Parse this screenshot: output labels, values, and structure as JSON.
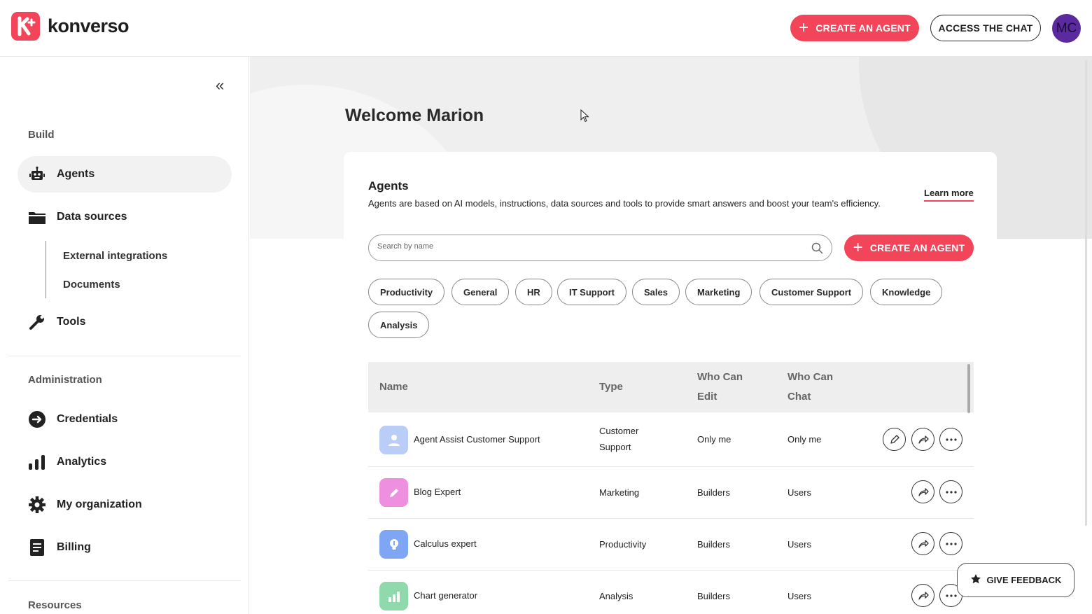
{
  "brand": {
    "name": "konverso",
    "color": "#f2455a"
  },
  "header": {
    "create_agent_label": "CREATE AN AGENT",
    "access_chat_label": "ACCESS THE CHAT",
    "avatar_initials": "MC",
    "avatar_color": "#5b2a9e"
  },
  "sidebar": {
    "collapse_glyph": "«",
    "build_label": "Build",
    "nav_build": [
      {
        "label": "Agents",
        "icon": "robot-icon",
        "active": true
      },
      {
        "label": "Data sources",
        "icon": "folder-icon"
      },
      {
        "label": "Tools",
        "icon": "wrench-icon"
      }
    ],
    "data_sources_sub": [
      "External integrations",
      "Documents"
    ],
    "administration_label": "Administration",
    "nav_admin": [
      {
        "label": "Credentials",
        "icon": "login-arrow-icon"
      },
      {
        "label": "Analytics",
        "icon": "bar-chart-icon"
      },
      {
        "label": "My organization",
        "icon": "gear-icon"
      },
      {
        "label": "Billing",
        "icon": "invoice-icon"
      }
    ],
    "resources_label": "Resources"
  },
  "main": {
    "welcome": "Welcome Marion",
    "agents_title": "Agents",
    "agents_desc": "Agents are based on AI models, instructions, data sources and tools to provide smart answers and boost your team's efficiency.",
    "learn_more": "Learn more",
    "search_placeholder": "Search by name",
    "create_agent_label": "CREATE AN AGENT",
    "categories": [
      "Productivity",
      "General",
      "HR",
      "IT Support",
      "Sales",
      "Marketing",
      "Customer Support",
      "Knowledge",
      "Analysis"
    ],
    "table": {
      "headers": {
        "name": "Name",
        "type": "Type",
        "who_edit": "Who Can Edit",
        "who_chat": "Who Can Chat"
      },
      "rows": [
        {
          "name": "Agent Assist Customer Support",
          "type": "Customer Support",
          "edit": "Only me",
          "chat": "Only me",
          "icon": "user-icon",
          "color": "#b9cdf7"
        },
        {
          "name": "Blog Expert",
          "type": "Marketing",
          "edit": "Builders",
          "chat": "Users",
          "icon": "pencil-icon",
          "color": "#ef8fe0"
        },
        {
          "name": "Calculus expert",
          "type": "Productivity",
          "edit": "Builders",
          "chat": "Users",
          "icon": "lightbulb-icon",
          "color": "#7fa6f5"
        },
        {
          "name": "Chart generator",
          "type": "Analysis",
          "edit": "Builders",
          "chat": "Users",
          "icon": "chart-icon",
          "color": "#8fd9ad"
        }
      ]
    }
  },
  "feedback_label": "GIVE FEEDBACK"
}
